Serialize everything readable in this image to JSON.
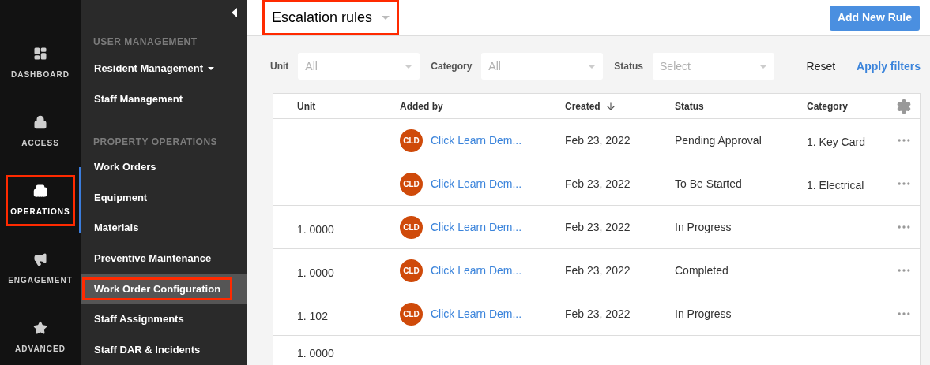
{
  "rail": [
    {
      "label": "DASHBOARD",
      "selected": false,
      "highlighted": false
    },
    {
      "label": "ACCESS",
      "selected": false,
      "highlighted": false
    },
    {
      "label": "OPERATIONS",
      "selected": true,
      "highlighted": true
    },
    {
      "label": "ENGAGEMENT",
      "selected": false,
      "highlighted": false
    },
    {
      "label": "ADVANCED",
      "selected": false,
      "highlighted": false
    }
  ],
  "menu": [
    {
      "kind": "heading",
      "label": "USER MANAGEMENT"
    },
    {
      "kind": "dropdown",
      "label": "Resident Management",
      "selected": false,
      "highlighted": false
    },
    {
      "kind": "item",
      "label": "Staff Management",
      "selected": false,
      "highlighted": false
    },
    {
      "kind": "heading",
      "label": "PROPERTY OPERATIONS"
    },
    {
      "kind": "item",
      "label": "Work Orders",
      "selected": false,
      "highlighted": false
    },
    {
      "kind": "item",
      "label": "Equipment",
      "selected": false,
      "highlighted": false
    },
    {
      "kind": "item",
      "label": "Materials",
      "selected": false,
      "highlighted": false
    },
    {
      "kind": "item",
      "label": "Preventive Maintenance",
      "selected": false,
      "highlighted": false
    },
    {
      "kind": "item",
      "label": "Work Order Configuration",
      "selected": true,
      "highlighted": true
    },
    {
      "kind": "item",
      "label": "Staff Assignments",
      "selected": false,
      "highlighted": false
    },
    {
      "kind": "item",
      "label": "Staff DAR & Incidents",
      "selected": false,
      "highlighted": false
    }
  ],
  "header": {
    "title": "Escalation rules",
    "title_highlighted": true,
    "add_button": "Add New Rule"
  },
  "filters": [
    {
      "label": "Unit",
      "placeholder": "All"
    },
    {
      "label": "Category",
      "placeholder": "All"
    },
    {
      "label": "Status",
      "placeholder": "Select"
    }
  ],
  "reset": "Reset",
  "apply": "Apply filters",
  "table": {
    "columns": [
      {
        "label": "Unit",
        "sorted": false
      },
      {
        "label": "Added by",
        "sorted": false
      },
      {
        "label": "Created",
        "sorted": true
      },
      {
        "label": "Status",
        "sorted": false
      },
      {
        "label": "Category",
        "sorted": false
      }
    ],
    "rows": [
      {
        "unit": "",
        "avatar": "CLD",
        "added_by": "Click Learn Dem...",
        "created": "Feb 23, 2022",
        "status": "Pending Approval",
        "category": "1. Key Card"
      },
      {
        "unit": "",
        "avatar": "CLD",
        "added_by": "Click Learn Dem...",
        "created": "Feb 23, 2022",
        "status": "To Be Started",
        "category": "1. Electrical"
      },
      {
        "unit": "1. 0000",
        "avatar": "CLD",
        "added_by": "Click Learn Dem...",
        "created": "Feb 23, 2022",
        "status": "In Progress",
        "category": ""
      },
      {
        "unit": "1. 0000",
        "avatar": "CLD",
        "added_by": "Click Learn Dem...",
        "created": "Feb 23, 2022",
        "status": "Completed",
        "category": ""
      },
      {
        "unit": "1. 102",
        "avatar": "CLD",
        "added_by": "Click Learn Dem...",
        "created": "Feb 23, 2022",
        "status": "In Progress",
        "category": ""
      },
      {
        "unit": "1. 0000",
        "avatar": "",
        "added_by": "",
        "created": "",
        "status": "",
        "category": ""
      }
    ]
  }
}
